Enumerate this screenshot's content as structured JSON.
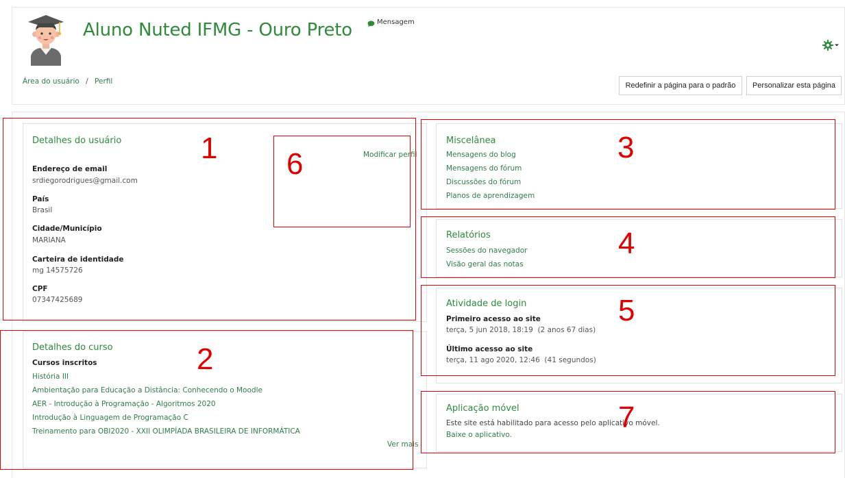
{
  "user": {
    "name": "Aluno Nuted IFMG - Ouro Preto",
    "message_link": "Mensagem"
  },
  "breadcrumb": {
    "home": "Área do usuário",
    "separator": "/",
    "current": "Perfil"
  },
  "buttons": {
    "reset": "Redefinir a página para o padrão",
    "customize": "Personalizar esta página"
  },
  "icons": {
    "gear": "gear-icon",
    "avatar": "graduate-avatar",
    "message": "speech-bubble-icon"
  },
  "user_details": {
    "title": "Detalhes do usuário",
    "edit_link": "Modificar perfil",
    "fields": [
      {
        "label": "Endereço de email",
        "value": "srdiegorodrigues@gmail.com"
      },
      {
        "label": "País",
        "value": "Brasil"
      },
      {
        "label": "Cidade/Município",
        "value": "MARIANA"
      },
      {
        "label": "Carteira de identidade",
        "value": "mg 14575726"
      },
      {
        "label": "CPF",
        "value": "07347425689"
      }
    ]
  },
  "course_details": {
    "title": "Detalhes do curso",
    "enrolled_label": "Cursos inscritos",
    "courses": [
      "História III",
      "Ambientação para Educação a Distância: Conhecendo o Moodle",
      "AER - Introdução à Programação - Algoritmos 2020",
      "Introdução à Linguagem de Programação C",
      "Treinamento para OBI2020 - XXII OLIMPÍADA BRASILEIRA DE INFORMÁTICA"
    ],
    "more_link": "Ver mais"
  },
  "misc": {
    "title": "Miscelânea",
    "links": [
      "Mensagens do blog",
      "Mensagens do fórum",
      "Discussões do fórum",
      "Planos de aprendizagem"
    ]
  },
  "reports": {
    "title": "Relatórios",
    "links": [
      "Sessões do navegador",
      "Visão geral das notas"
    ]
  },
  "login_activity": {
    "title": "Atividade de login",
    "first_label": "Primeiro acesso ao site",
    "first_value": "terça, 5 jun 2018, 18:19  (2 anos 67 dias)",
    "last_label": "Último acesso ao site",
    "last_value": "terça, 11 ago 2020, 12:46  (41 segundos)"
  },
  "mobile_app": {
    "title": "Aplicação móvel",
    "text": "Este site está habilitado para acesso pelo aplicativo móvel.",
    "link": "Baixe o aplicativo."
  },
  "annotations": [
    "1",
    "2",
    "3",
    "4",
    "5",
    "6",
    "7"
  ],
  "colors": {
    "brand_green": "#2e8b3a",
    "annotation_red": "#e00000"
  }
}
